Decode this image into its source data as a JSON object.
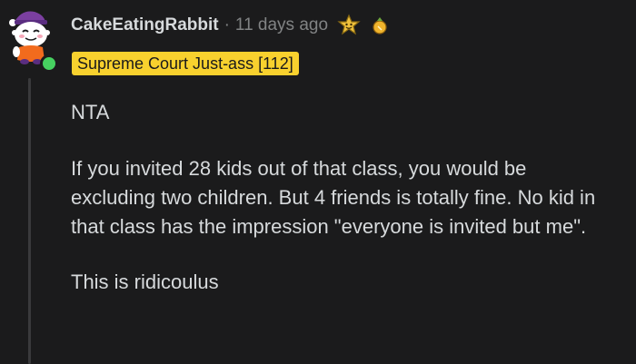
{
  "comment": {
    "username": "CakeEatingRabbit",
    "separator": "·",
    "timestamp": "11 days ago",
    "award_icons": [
      "helpful-award-icon",
      "gold-award-icon"
    ],
    "flair": "Supreme Court Just-ass [112]",
    "paragraphs": [
      "NTA",
      "If you invited 28 kids out of that class, you would be excluding two children. But 4 friends is totally fine. No kid in that class has the impression \"everyone is invited but me\".",
      "This is ridicoulus"
    ]
  },
  "colors": {
    "background": "#1b1b1c",
    "text": "#d7dadc",
    "muted": "#818384",
    "flair_bg": "#f8d12e",
    "online": "#46d160"
  }
}
